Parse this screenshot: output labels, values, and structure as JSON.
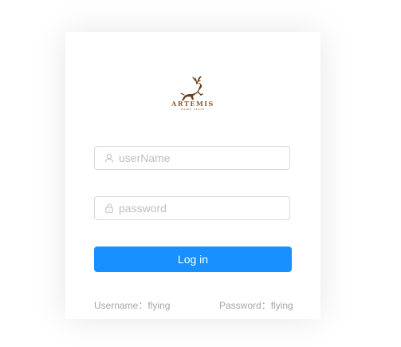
{
  "logo": {
    "name": "ARTEMIS",
    "tagline": "Game store"
  },
  "form": {
    "username_placeholder": "userName",
    "username_value": "",
    "password_placeholder": "password",
    "password_value": "",
    "login_label": "Log in"
  },
  "hints": {
    "username": "Username：flying",
    "password": "Password：flying"
  },
  "colors": {
    "primary": "#1890ff",
    "logo_brown": "#8a5a2e",
    "border": "#d9d9d9",
    "hint": "#a6a6a6"
  },
  "icons": {
    "username": "user-icon",
    "password": "lock-icon"
  }
}
